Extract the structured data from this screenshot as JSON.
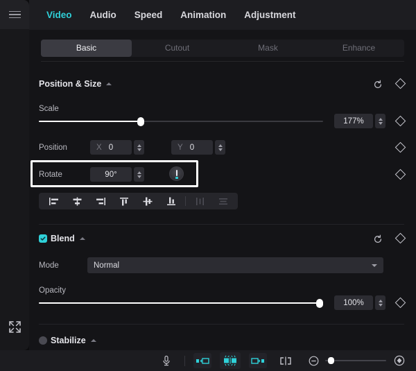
{
  "app": {
    "accent": "#2fd0d8",
    "panel_bg": "#141417",
    "rail_bg": "#18181b"
  },
  "left_rail": {
    "menu_icon": "hamburger-menu-icon",
    "expand_icon": "expand-fullscreen-icon"
  },
  "tabs": [
    {
      "label": "Video",
      "active": true
    },
    {
      "label": "Audio",
      "active": false
    },
    {
      "label": "Speed",
      "active": false
    },
    {
      "label": "Animation",
      "active": false
    },
    {
      "label": "Adjustment",
      "active": false
    }
  ],
  "subtabs": [
    {
      "label": "Basic",
      "active": true
    },
    {
      "label": "Cutout",
      "active": false
    },
    {
      "label": "Mask",
      "active": false
    },
    {
      "label": "Enhance",
      "active": false
    }
  ],
  "position_size": {
    "title": "Position & Size",
    "scale": {
      "label": "Scale",
      "value": "177%",
      "percent": 36
    },
    "position": {
      "label": "Position",
      "x_axis": "X",
      "x_value": "0",
      "y_axis": "Y",
      "y_value": "0"
    },
    "rotate": {
      "label": "Rotate",
      "value": "90°"
    },
    "align_buttons": [
      {
        "name": "align-left",
        "enabled": true
      },
      {
        "name": "align-center-horizontal",
        "enabled": true
      },
      {
        "name": "align-right",
        "enabled": true
      },
      {
        "name": "align-top",
        "enabled": true
      },
      {
        "name": "align-center-vertical",
        "enabled": true
      },
      {
        "name": "align-bottom",
        "enabled": true
      },
      {
        "name": "distribute-horizontal",
        "enabled": false
      },
      {
        "name": "distribute-vertical",
        "enabled": false
      }
    ]
  },
  "blend": {
    "title": "Blend",
    "checked": true,
    "mode_label": "Mode",
    "mode_value": "Normal",
    "opacity_label": "Opacity",
    "opacity_value": "100%",
    "opacity_percent": 100
  },
  "stabilize": {
    "title": "Stabilize",
    "checked": false
  },
  "bottom_bar": {
    "mic_icon": "microphone-icon",
    "tool1_icon": "trim-start-icon",
    "tool2_icon": "auto-cut-icon",
    "tool3_icon": "trim-end-icon",
    "split_icon": "split-clip-icon",
    "zoom_out_icon": "zoom-out-icon",
    "zoom_fit_icon": "zoom-to-fit-icon",
    "zoom_percent": 6
  }
}
